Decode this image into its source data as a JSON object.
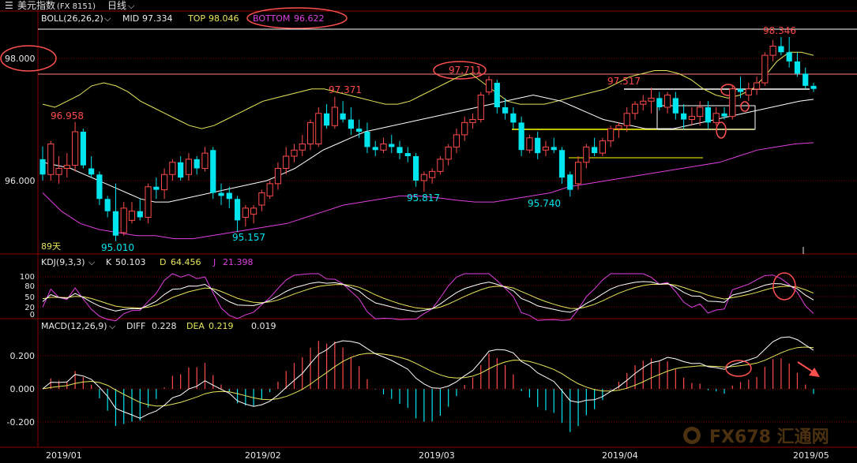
{
  "header": {
    "symbol_title": "美元指数",
    "symbol_code": "(FX 8151)",
    "period": "日线",
    "period_arrow": "⌵"
  },
  "boll": {
    "label": "BOLL(26,26,2)",
    "mid_label": "MID",
    "mid_value": "97.334",
    "top_label": "TOP",
    "top_value": "98.046",
    "bottom_label": "BOTTOM",
    "bottom_value": "96.622"
  },
  "kdj": {
    "label": "KDJ(9,3,3)",
    "k_label": "K",
    "k_value": "50.103",
    "d_label": "D",
    "d_value": "64.456",
    "j_label": "J",
    "j_value": "21.398",
    "ticks": [
      "100",
      "80",
      "50",
      "20",
      "0"
    ]
  },
  "macd": {
    "label": "MACD(12,26,9)",
    "diff_label": "DIFF",
    "diff_value": "0.228",
    "dea_label": "DEA",
    "dea_value": "0.219",
    "macd_value": "0.019",
    "ticks": [
      "0.200",
      "0.000",
      "-0.200"
    ]
  },
  "price_axis": [
    "98.000",
    "96.000"
  ],
  "date_axis": [
    "2019/01",
    "2019/02",
    "2019/03",
    "2019/04",
    "2019/05"
  ],
  "period_label": "89天",
  "watermark": "FX678 汇通网",
  "colors": {
    "up": "#ff4a4a",
    "down": "#00e5ee",
    "mid_band": "#e6e65a",
    "upper_lower_band": "#e040e0",
    "kdj_k": "#ffffff",
    "kdj_d": "#e6e65a",
    "kdj_j": "#e040e0",
    "annotation": "#ff5050"
  },
  "chart_data": {
    "type": "candlestick",
    "price_annotations": [
      "96.958",
      "95.010",
      "95.157",
      "97.371",
      "97.711",
      "95.817",
      "95.740",
      "97.517",
      "98.346"
    ],
    "candles": [
      {
        "o": 96.35,
        "h": 96.56,
        "l": 96.0,
        "c": 96.1
      },
      {
        "o": 96.1,
        "h": 96.65,
        "l": 96.0,
        "c": 96.6
      },
      {
        "o": 96.1,
        "h": 96.4,
        "l": 95.95,
        "c": 96.2
      },
      {
        "o": 96.2,
        "h": 96.45,
        "l": 96.05,
        "c": 96.25
      },
      {
        "o": 96.25,
        "h": 96.96,
        "l": 96.15,
        "c": 96.8
      },
      {
        "o": 96.8,
        "h": 96.85,
        "l": 96.2,
        "c": 96.25
      },
      {
        "o": 96.2,
        "h": 96.4,
        "l": 96.05,
        "c": 96.1
      },
      {
        "o": 96.1,
        "h": 96.15,
        "l": 95.6,
        "c": 95.7
      },
      {
        "o": 95.7,
        "h": 95.75,
        "l": 95.4,
        "c": 95.5
      },
      {
        "o": 95.5,
        "h": 95.95,
        "l": 95.01,
        "c": 95.1
      },
      {
        "o": 95.15,
        "h": 95.65,
        "l": 95.1,
        "c": 95.55
      },
      {
        "o": 95.35,
        "h": 95.65,
        "l": 95.3,
        "c": 95.5
      },
      {
        "o": 95.5,
        "h": 95.7,
        "l": 95.35,
        "c": 95.4
      },
      {
        "o": 95.4,
        "h": 95.95,
        "l": 95.3,
        "c": 95.9
      },
      {
        "o": 95.9,
        "h": 96.05,
        "l": 95.7,
        "c": 95.85
      },
      {
        "o": 95.85,
        "h": 96.2,
        "l": 95.7,
        "c": 96.1
      },
      {
        "o": 96.1,
        "h": 96.35,
        "l": 96.0,
        "c": 96.3
      },
      {
        "o": 96.3,
        "h": 96.4,
        "l": 96.0,
        "c": 96.05
      },
      {
        "o": 96.1,
        "h": 96.45,
        "l": 96.0,
        "c": 96.35
      },
      {
        "o": 96.35,
        "h": 96.4,
        "l": 96.1,
        "c": 96.2
      },
      {
        "o": 96.2,
        "h": 96.55,
        "l": 96.15,
        "c": 96.45
      },
      {
        "o": 96.5,
        "h": 96.55,
        "l": 95.7,
        "c": 95.8
      },
      {
        "o": 95.8,
        "h": 95.95,
        "l": 95.6,
        "c": 95.75
      },
      {
        "o": 95.8,
        "h": 95.9,
        "l": 95.55,
        "c": 95.7
      },
      {
        "o": 95.7,
        "h": 95.75,
        "l": 95.16,
        "c": 95.35
      },
      {
        "o": 95.4,
        "h": 95.6,
        "l": 95.25,
        "c": 95.55
      },
      {
        "o": 95.45,
        "h": 95.6,
        "l": 95.3,
        "c": 95.55
      },
      {
        "o": 95.6,
        "h": 95.85,
        "l": 95.5,
        "c": 95.8
      },
      {
        "o": 95.75,
        "h": 96.0,
        "l": 95.7,
        "c": 95.95
      },
      {
        "o": 95.95,
        "h": 96.3,
        "l": 95.85,
        "c": 96.2
      },
      {
        "o": 96.2,
        "h": 96.55,
        "l": 96.1,
        "c": 96.4
      },
      {
        "o": 96.4,
        "h": 96.6,
        "l": 96.3,
        "c": 96.5
      },
      {
        "o": 96.5,
        "h": 96.75,
        "l": 96.4,
        "c": 96.6
      },
      {
        "o": 96.6,
        "h": 97.0,
        "l": 96.5,
        "c": 96.95
      },
      {
        "o": 96.6,
        "h": 97.2,
        "l": 96.55,
        "c": 97.1
      },
      {
        "o": 97.1,
        "h": 97.25,
        "l": 96.85,
        "c": 96.9
      },
      {
        "o": 96.9,
        "h": 97.37,
        "l": 96.85,
        "c": 97.2
      },
      {
        "o": 97.1,
        "h": 97.3,
        "l": 96.95,
        "c": 97.0
      },
      {
        "o": 97.0,
        "h": 97.2,
        "l": 96.75,
        "c": 96.85
      },
      {
        "o": 96.85,
        "h": 97.0,
        "l": 96.7,
        "c": 96.8
      },
      {
        "o": 96.8,
        "h": 96.95,
        "l": 96.45,
        "c": 96.55
      },
      {
        "o": 96.55,
        "h": 96.65,
        "l": 96.4,
        "c": 96.5
      },
      {
        "o": 96.5,
        "h": 96.7,
        "l": 96.45,
        "c": 96.6
      },
      {
        "o": 96.6,
        "h": 96.75,
        "l": 96.45,
        "c": 96.55
      },
      {
        "o": 96.55,
        "h": 96.65,
        "l": 96.35,
        "c": 96.45
      },
      {
        "o": 96.45,
        "h": 96.55,
        "l": 96.3,
        "c": 96.4
      },
      {
        "o": 96.4,
        "h": 96.45,
        "l": 95.9,
        "c": 96.0
      },
      {
        "o": 96.0,
        "h": 96.15,
        "l": 95.82,
        "c": 96.1
      },
      {
        "o": 96.05,
        "h": 96.2,
        "l": 95.95,
        "c": 96.15
      },
      {
        "o": 96.15,
        "h": 96.4,
        "l": 96.1,
        "c": 96.35
      },
      {
        "o": 96.35,
        "h": 96.6,
        "l": 96.25,
        "c": 96.55
      },
      {
        "o": 96.55,
        "h": 96.85,
        "l": 96.45,
        "c": 96.75
      },
      {
        "o": 96.75,
        "h": 97.05,
        "l": 96.65,
        "c": 96.95
      },
      {
        "o": 96.95,
        "h": 97.1,
        "l": 96.85,
        "c": 97.0
      },
      {
        "o": 97.0,
        "h": 97.45,
        "l": 96.95,
        "c": 97.4
      },
      {
        "o": 97.45,
        "h": 97.71,
        "l": 97.4,
        "c": 97.65
      },
      {
        "o": 97.6,
        "h": 97.65,
        "l": 97.1,
        "c": 97.2
      },
      {
        "o": 97.2,
        "h": 97.35,
        "l": 97.0,
        "c": 97.1
      },
      {
        "o": 97.1,
        "h": 97.2,
        "l": 96.85,
        "c": 96.95
      },
      {
        "o": 96.95,
        "h": 97.05,
        "l": 96.4,
        "c": 96.5
      },
      {
        "o": 96.5,
        "h": 96.75,
        "l": 96.45,
        "c": 96.7
      },
      {
        "o": 96.7,
        "h": 96.8,
        "l": 96.35,
        "c": 96.45
      },
      {
        "o": 96.5,
        "h": 96.65,
        "l": 96.4,
        "c": 96.55
      },
      {
        "o": 96.55,
        "h": 96.7,
        "l": 96.45,
        "c": 96.5
      },
      {
        "o": 96.5,
        "h": 96.55,
        "l": 95.95,
        "c": 96.05
      },
      {
        "o": 96.1,
        "h": 96.15,
        "l": 95.74,
        "c": 95.85
      },
      {
        "o": 95.95,
        "h": 96.4,
        "l": 95.85,
        "c": 96.3
      },
      {
        "o": 96.3,
        "h": 96.6,
        "l": 96.2,
        "c": 96.55
      },
      {
        "o": 96.55,
        "h": 96.7,
        "l": 96.4,
        "c": 96.45
      },
      {
        "o": 96.45,
        "h": 96.7,
        "l": 96.4,
        "c": 96.65
      },
      {
        "o": 96.65,
        "h": 96.9,
        "l": 96.55,
        "c": 96.85
      },
      {
        "o": 96.85,
        "h": 96.95,
        "l": 96.7,
        "c": 96.9
      },
      {
        "o": 96.9,
        "h": 97.2,
        "l": 96.8,
        "c": 97.1
      },
      {
        "o": 97.1,
        "h": 97.3,
        "l": 97.0,
        "c": 97.25
      },
      {
        "o": 97.25,
        "h": 97.4,
        "l": 97.15,
        "c": 97.3
      },
      {
        "o": 97.3,
        "h": 97.52,
        "l": 97.1,
        "c": 97.35
      },
      {
        "o": 97.35,
        "h": 97.45,
        "l": 97.15,
        "c": 97.2
      },
      {
        "o": 97.2,
        "h": 97.45,
        "l": 97.1,
        "c": 97.4
      },
      {
        "o": 97.35,
        "h": 97.45,
        "l": 97.0,
        "c": 97.1
      },
      {
        "o": 97.1,
        "h": 97.25,
        "l": 96.85,
        "c": 97.0
      },
      {
        "o": 97.0,
        "h": 97.2,
        "l": 96.9,
        "c": 97.05
      },
      {
        "o": 97.05,
        "h": 97.3,
        "l": 96.9,
        "c": 97.2
      },
      {
        "o": 97.2,
        "h": 97.3,
        "l": 96.85,
        "c": 96.95
      },
      {
        "o": 96.95,
        "h": 97.2,
        "l": 96.9,
        "c": 97.1
      },
      {
        "o": 97.1,
        "h": 97.2,
        "l": 97.0,
        "c": 97.05
      },
      {
        "o": 97.05,
        "h": 97.55,
        "l": 97.0,
        "c": 97.5
      },
      {
        "o": 97.5,
        "h": 97.7,
        "l": 97.35,
        "c": 97.45
      },
      {
        "o": 97.4,
        "h": 97.6,
        "l": 97.3,
        "c": 97.5
      },
      {
        "o": 97.5,
        "h": 97.7,
        "l": 97.4,
        "c": 97.6
      },
      {
        "o": 97.6,
        "h": 98.1,
        "l": 97.55,
        "c": 98.05
      },
      {
        "o": 98.05,
        "h": 98.3,
        "l": 97.95,
        "c": 98.2
      },
      {
        "o": 98.2,
        "h": 98.35,
        "l": 98.05,
        "c": 98.1
      },
      {
        "o": 98.1,
        "h": 98.35,
        "l": 97.85,
        "c": 97.95
      },
      {
        "o": 97.95,
        "h": 98.1,
        "l": 97.7,
        "c": 97.75
      },
      {
        "o": 97.75,
        "h": 97.85,
        "l": 97.5,
        "c": 97.55
      },
      {
        "o": 97.55,
        "h": 97.6,
        "l": 97.45,
        "c": 97.5
      }
    ],
    "boll_mid": [
      96.3,
      96.25,
      96.2,
      96.1,
      96.0,
      95.9,
      95.8,
      95.7,
      95.65,
      95.65,
      95.7,
      95.75,
      95.8,
      95.85,
      95.9,
      95.95,
      96.0,
      96.1,
      96.2,
      96.35,
      96.5,
      96.6,
      96.7,
      96.8,
      96.85,
      96.9,
      96.95,
      97.0,
      97.05,
      97.1,
      97.15,
      97.2,
      97.25,
      97.3,
      97.35,
      97.4,
      97.35,
      97.3,
      97.2,
      97.1,
      97.0,
      96.95,
      96.9,
      96.85,
      96.85,
      96.85,
      96.9,
      96.95,
      97.0,
      97.05,
      97.1,
      97.15,
      97.2,
      97.25,
      97.3,
      97.33
    ],
    "boll_top": [
      97.25,
      97.2,
      97.3,
      97.4,
      97.55,
      97.6,
      97.55,
      97.45,
      97.3,
      97.2,
      97.1,
      97.0,
      96.9,
      96.85,
      96.9,
      97.0,
      97.1,
      97.2,
      97.3,
      97.35,
      97.4,
      97.45,
      97.5,
      97.5,
      97.45,
      97.4,
      97.35,
      97.3,
      97.25,
      97.25,
      97.3,
      97.4,
      97.5,
      97.6,
      97.7,
      97.75,
      97.6,
      97.45,
      97.3,
      97.25,
      97.25,
      97.25,
      97.3,
      97.35,
      97.4,
      97.45,
      97.5,
      97.6,
      97.7,
      97.75,
      97.8,
      97.8,
      97.75,
      97.65,
      97.5,
      97.4,
      97.35,
      97.4,
      97.5,
      97.7,
      97.95,
      98.1,
      98.1,
      98.05
    ],
    "boll_bottom": [
      95.8,
      95.5,
      95.3,
      95.2,
      95.15,
      95.1,
      95.1,
      95.05,
      95.05,
      95.1,
      95.15,
      95.2,
      95.25,
      95.3,
      95.4,
      95.5,
      95.6,
      95.65,
      95.7,
      95.75,
      95.75,
      95.72,
      95.68,
      95.65,
      95.65,
      95.7,
      95.75,
      95.8,
      95.9,
      95.95,
      96.0,
      96.05,
      96.1,
      96.15,
      96.2,
      96.25,
      96.3,
      96.4,
      96.5,
      96.55,
      96.6,
      96.62
    ],
    "kdj_ticks": [
      100,
      80,
      50,
      20,
      0
    ],
    "macd_ticks": [
      0.2,
      0.0,
      -0.2
    ],
    "ylim": [
      94.8,
      98.6
    ]
  }
}
